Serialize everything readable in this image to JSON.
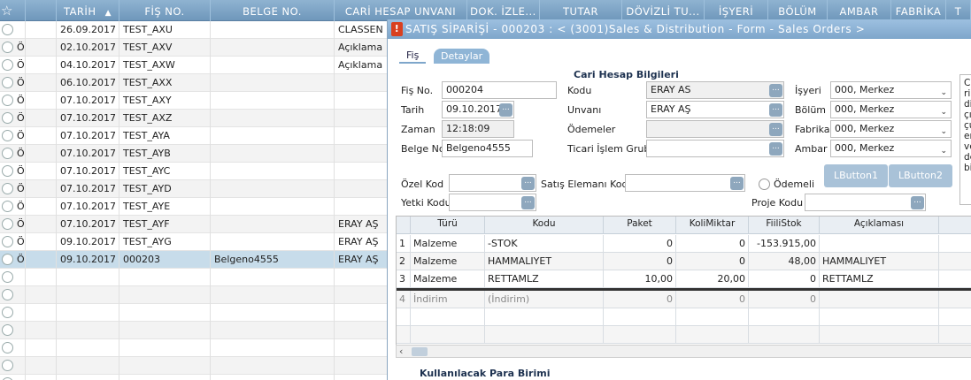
{
  "list": {
    "columns": [
      "TARİH",
      "FİŞ NO.",
      "BELGE NO.",
      "CARİ HESAP UNVANI",
      "DOK. İZLE...",
      "TUTAR",
      "DÖVİZLİ TU...",
      "İŞYERİ",
      "BÖLÜM",
      "AMBAR",
      "FABRİKA",
      "T"
    ],
    "sort_arrow": "▲",
    "star": "☆",
    "rows": [
      {
        "flag": "",
        "date": "26.09.2017",
        "fis": "TEST_AXU",
        "belge": "",
        "cari": "CLASSEN"
      },
      {
        "flag": "Ö",
        "date": "02.10.2017",
        "fis": "TEST_AXV",
        "belge": "",
        "cari": "Açıklama"
      },
      {
        "flag": "Ö",
        "date": "04.10.2017",
        "fis": "TEST_AXW",
        "belge": "",
        "cari": "Açıklama"
      },
      {
        "flag": "Ö",
        "date": "06.10.2017",
        "fis": "TEST_AXX",
        "belge": "",
        "cari": ""
      },
      {
        "flag": "Ö",
        "date": "07.10.2017",
        "fis": "TEST_AXY",
        "belge": "",
        "cari": ""
      },
      {
        "flag": "Ö",
        "date": "07.10.2017",
        "fis": "TEST_AXZ",
        "belge": "",
        "cari": ""
      },
      {
        "flag": "Ö",
        "date": "07.10.2017",
        "fis": "TEST_AYA",
        "belge": "",
        "cari": ""
      },
      {
        "flag": "Ö",
        "date": "07.10.2017",
        "fis": "TEST_AYB",
        "belge": "",
        "cari": ""
      },
      {
        "flag": "Ö",
        "date": "07.10.2017",
        "fis": "TEST_AYC",
        "belge": "",
        "cari": ""
      },
      {
        "flag": "Ö",
        "date": "07.10.2017",
        "fis": "TEST_AYD",
        "belge": "",
        "cari": ""
      },
      {
        "flag": "Ö",
        "date": "07.10.2017",
        "fis": "TEST_AYE",
        "belge": "",
        "cari": ""
      },
      {
        "flag": "Ö",
        "date": "07.10.2017",
        "fis": "TEST_AYF",
        "belge": "",
        "cari": "ERAY AŞ"
      },
      {
        "flag": "Ö",
        "date": "09.10.2017",
        "fis": "TEST_AYG",
        "belge": "",
        "cari": "ERAY AŞ"
      },
      {
        "flag": "Ö",
        "date": "09.10.2017",
        "fis": "000203",
        "belge": "Belgeno4555",
        "cari": "ERAY AŞ"
      },
      {
        "flag": "",
        "date": "",
        "fis": "",
        "belge": "",
        "cari": ""
      },
      {
        "flag": "",
        "date": "",
        "fis": "",
        "belge": "",
        "cari": ""
      },
      {
        "flag": "",
        "date": "",
        "fis": "",
        "belge": "",
        "cari": ""
      },
      {
        "flag": "",
        "date": "",
        "fis": "",
        "belge": "",
        "cari": ""
      },
      {
        "flag": "",
        "date": "",
        "fis": "",
        "belge": "",
        "cari": ""
      },
      {
        "flag": "",
        "date": "",
        "fis": "",
        "belge": "",
        "cari": ""
      },
      {
        "flag": "",
        "date": "",
        "fis": "",
        "belge": "",
        "cari": ""
      }
    ],
    "selected_row": 13
  },
  "window": {
    "title": "SATIŞ SİPARİŞİ - 000203 : < (3001)Sales & Distribution - Form - Sales Orders >",
    "icon_glyph": "!",
    "tabs": [
      "Fiş",
      "Detaylar"
    ],
    "section_title": "Cari Hesap Bilgileri",
    "fis_no_label": "Fiş No.",
    "fis_no": "000204",
    "tarih_label": "Tarih",
    "tarih": "09.10.2017",
    "zaman_label": "Zaman",
    "zaman": "12:18:09",
    "belge_no_label": "Belge No.",
    "belge_no": "Belgeno4555",
    "kodu_label": "Kodu",
    "kodu": "ERAY AS",
    "unvani_label": "Unvanı",
    "unvani": "ERAY AŞ",
    "odemeler_label": "Ödemeler",
    "odemeler": "",
    "ticari_label": "Ticari İşlem Grubu",
    "ticari": "",
    "isyeri_label": "İşyeri",
    "isyeri": "000, Merkez",
    "bolum_label": "Bölüm",
    "bolum": "000, Merkez",
    "fabrika_label": "Fabrika",
    "fabrika": "000, Merkez",
    "ambar_label": "Ambar",
    "ambar": "000, Merkez",
    "memo_text": "C\nri\ndi\nçı\nçu\nen\nve\nde\nbi",
    "lbutton1": "LButton1",
    "lbutton2": "LButton2",
    "ozel_kod_label": "Özel Kod",
    "ozel_kod": "",
    "satis_label": "Satış Elemanı Kodu",
    "satis": "",
    "odemeli_label": "Ödemeli",
    "yetki_label": "Yetki Kodu",
    "yetki": "",
    "proje_label": "Proje Kodu",
    "proje": "",
    "dots": "...",
    "select_arrow": "⌄",
    "scroll_left": "‹",
    "bottom_title": "Kullanılacak Para Birimi"
  },
  "grid": {
    "columns": [
      "Türü",
      "Kodu",
      "Paket",
      "KoliMiktar",
      "FiiliStok",
      "Açıklaması"
    ],
    "rows": [
      {
        "no": "1",
        "turu": "Malzeme",
        "kodu": "-STOK",
        "paket": "0",
        "koli": "0",
        "stok": "-153.915,00",
        "aciklama": ""
      },
      {
        "no": "2",
        "turu": "Malzeme",
        "kodu": "HAMMALIYET",
        "paket": "0",
        "koli": "0",
        "stok": "48,00",
        "aciklama": "HAMMALIYET"
      },
      {
        "no": "3",
        "turu": "Malzeme",
        "kodu": "RETTAMLZ",
        "paket": "10,00",
        "koli": "20,00",
        "stok": "0",
        "aciklama": "RETTAMLZ"
      },
      {
        "no": "4",
        "turu": "İndirim",
        "kodu": "(İndirim)",
        "paket": "0",
        "koli": "0",
        "stok": "0",
        "aciklama": ""
      }
    ]
  }
}
